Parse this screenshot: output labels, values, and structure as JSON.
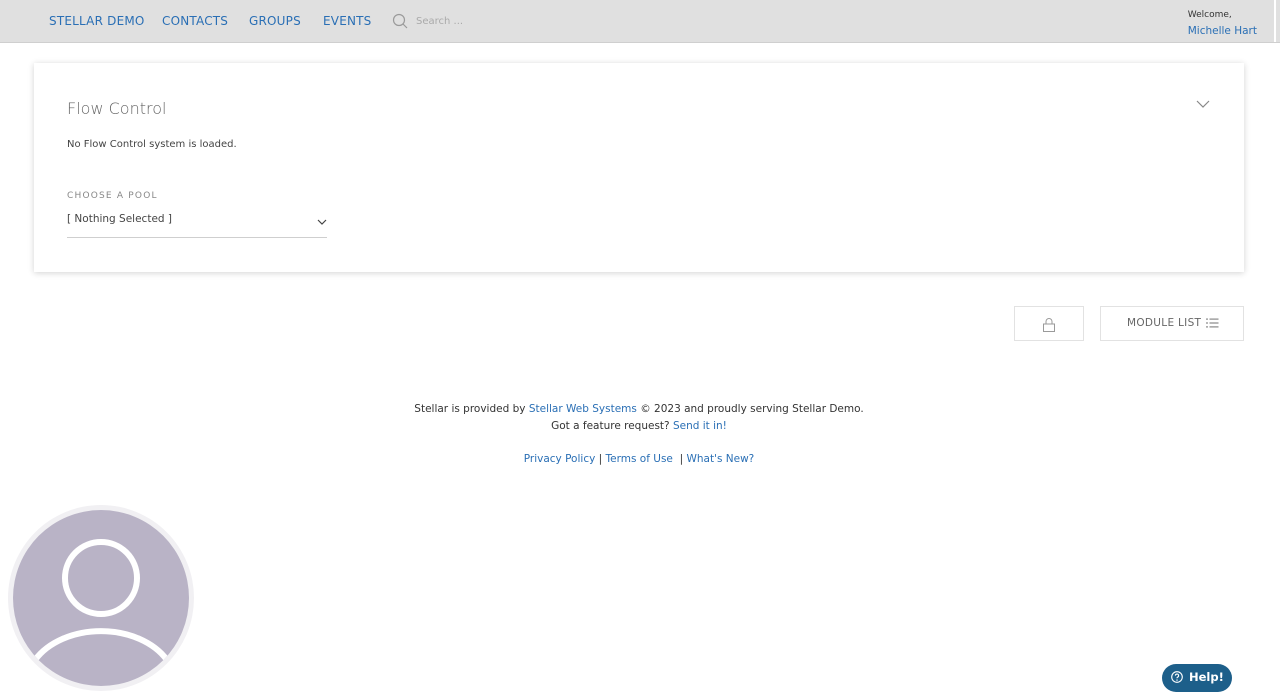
{
  "nav": {
    "brand": "STELLAR DEMO",
    "items": [
      "CONTACTS",
      "GROUPS",
      "EVENTS"
    ],
    "search_placeholder": "Search ...",
    "welcome_label": "Welcome,",
    "user_name": "Michelle Hart"
  },
  "panel": {
    "title": "Flow Control",
    "status": "No Flow Control system is loaded.",
    "pool_label": "CHOOSE A POOL",
    "pool_selected": "[ Nothing Selected ]"
  },
  "buttons": {
    "module_list": "MODULE LIST"
  },
  "footer": {
    "line1_prefix": "Stellar is provided by ",
    "provider_link": "Stellar Web Systems",
    "line1_suffix": " © 2023 and proudly serving Stellar Demo.",
    "line2_prefix": "Got a feature request? ",
    "send_link": "Send it in!",
    "privacy": "Privacy Policy",
    "terms": "Terms of Use",
    "whats_new": "What's New?",
    "sep": "|"
  },
  "help": {
    "label": "Help!"
  },
  "icons": {
    "search": "search-icon",
    "collapse": "chevron-down-icon",
    "select": "chevron-down-icon",
    "lock": "lock-icon",
    "list": "list-icon",
    "avatar": "user-icon",
    "help": "question-circle-icon"
  },
  "colors": {
    "link": "#2a6fb5",
    "topbar": "#e0e0e0",
    "avatar": "#b9b3c6",
    "help_button": "#1d5f8a"
  }
}
